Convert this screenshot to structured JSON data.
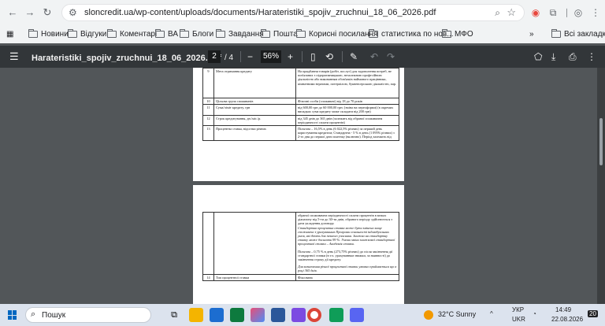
{
  "browser": {
    "url": "sloncredit.ua/wp-content/uploads/documents/Harateristiki_spojiv_zruchnui_18_06_2026.pdf",
    "bookmarks": [
      "Новини",
      "Відгуки",
      "Коментарі",
      "ВА",
      "Блоги",
      "Завдання",
      "Пошта",
      "Корисні посилання",
      "статистика по нов...",
      "МФО"
    ],
    "all_bookmarks": "Всі закладки"
  },
  "pdf": {
    "title": "Harateristiki_spojiv_zruchnui_18_06_2026.pdf",
    "page_current": "2",
    "page_total": "/ 4",
    "zoom": "56%"
  },
  "page1_rows": [
    {
      "n": "9",
      "k": "Мета отримання кредиту",
      "v": "На придбання товарів (робіт, послуг) для задоволення потреб, не пов'язаних з підприємницькою, незалежною професійною діяльністю або виконанням обов'язків найманого працівника, кімнатними втратами, потерпілою, буквенсерською діяльністю, пар."
    },
    {
      "n": "10",
      "k": "Цільова група споживачів",
      "v": "Фізичні особи (споживачі) від 18 до 70 років"
    },
    {
      "n": "11",
      "k": "Сума/ліміт кредиту, грн",
      "v": "від 600,00 грн до 60 000,00 грн; (зміна на переоформи) (в окремих випадках сума кредиту може складати від 200 грн)"
    },
    {
      "n": "12",
      "k": "Строк кредитування, дн./міс./р.",
      "v": "від 345 днів до 365 днів (залежить від обраної споживачем періодичності сплати процентів)"
    },
    {
      "n": "13",
      "k": "Процентна ставка, відсотки річних",
      "v": "Пільгова – 16,5% в день (6 022,5% річних) за перший день користування кредитом; Стандартна - 5 % в день (1 095% річних) з 2-го дня до першої дати платежу (включно). Період залежить від"
    }
  ],
  "page2_rows": [
    {
      "n": "",
      "k": "",
      "v": "обраної споживачем періодичності сплати процентів в межах діапазону від 5-ти до 30-ти днів, обраного періоду здійснюється з дати укладення договору.",
      "italic": "Стандартна процентна ставка може бути змінена вище споживача з урахуванням Програми лояльності індивідуальних умов, які діють для певного учасника. Знижка на стандартну ставку може досягати 99 %. Умови зміни знижкової стандартної процентної ставки – Академія ставки.",
      "v2": "Пільгова – 0,75 % в день (273,75% річних) до після закінчення дії стандартної ставки (в т.ч. урахуванням знижки, за наявності) до закінчення строку дії кредиту.",
      "italic2": "Для визначення річної процентної ставки умовно приймається що в році 365 днів."
    },
    {
      "n": "14",
      "k": "Тип процентної ставки",
      "v": "Фіксована"
    }
  ],
  "taskbar": {
    "search": "Пошук",
    "weather": "32°C  Sunny",
    "lang": "УКР",
    "lang2": "UKR",
    "time": "14:49",
    "date": "22.08.2026",
    "notif": "20"
  }
}
